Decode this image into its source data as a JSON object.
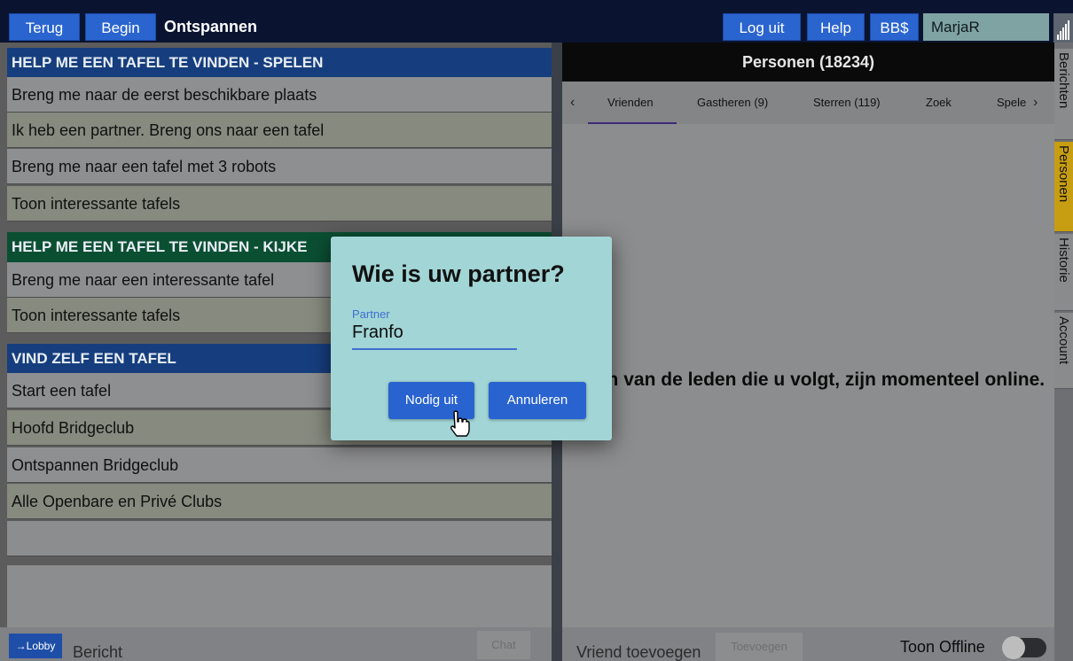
{
  "topbar": {
    "back_label": "Terug",
    "home_label": "Begin",
    "title": "Ontspannen",
    "logout_label": "Log uit",
    "help_label": "Help",
    "bbs_label": "BB$",
    "username": "MarjaR"
  },
  "left": {
    "play_section": {
      "heading": "HELP ME EEN TAFEL TE VINDEN - SPELEN",
      "items": [
        "Breng me naar de eerst beschikbare plaats",
        "Ik heb een partner. Breng ons naar een tafel",
        "Breng me naar een tafel met 3 robots",
        "Toon interessante tafels"
      ]
    },
    "watch_section": {
      "heading": "HELP ME EEN TAFEL TE VINDEN - KIJKE",
      "items": [
        "Breng me naar een interessante tafel",
        "Toon interessante tafels"
      ]
    },
    "own_section": {
      "heading": "VIND ZELF EEN TAFEL",
      "items": [
        "Start een tafel",
        "Hoofd Bridgeclub",
        "Ontspannen Bridgeclub",
        "Alle Openbare en Privé Clubs"
      ]
    },
    "chat": {
      "lobby_label": "→Lobby",
      "message_placeholder": "Bericht",
      "chat_label": "Chat"
    }
  },
  "right": {
    "header": "Personen (18234)",
    "tabs": [
      "Vrienden",
      "Gastheren (9)",
      "Sterren (119)",
      "Zoek",
      "Spele"
    ],
    "empty_message": "Geen van de leden die u volgt, zijn momenteel online.",
    "add_friend_placeholder": "Vriend toevoegen",
    "add_label": "Toevoegen",
    "show_offline_label": "Toon Offline"
  },
  "side_tabs": [
    "Berichten",
    "Personen",
    "Historie",
    "Account"
  ],
  "modal": {
    "title": "Wie is uw partner?",
    "field_label": "Partner",
    "field_value": "Franfo",
    "invite_label": "Nodig uit",
    "cancel_label": "Annuleren"
  },
  "colors": {
    "accent_blue": "#2963d0",
    "modal_bg": "#a2d5d6",
    "active_side_tab": "#c79d12"
  }
}
